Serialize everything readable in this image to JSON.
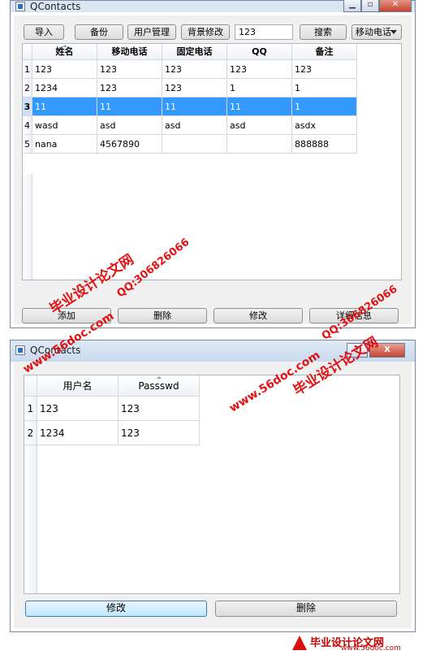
{
  "window1": {
    "title": "QContacts",
    "toolbar": {
      "import_label": "导入",
      "backup_label": "备份",
      "user_manage_label": "用户管理",
      "background_label": "背景修改",
      "search_value": "123",
      "search_button_label": "搜索",
      "search_field_option": "移动电话"
    },
    "table": {
      "headers": [
        "姓名",
        "移动电话",
        "固定电话",
        "QQ",
        "备注"
      ],
      "rows": [
        {
          "num": "1",
          "cells": [
            "123",
            "123",
            "123",
            "123",
            "123"
          ]
        },
        {
          "num": "2",
          "cells": [
            "1234",
            "123",
            "123",
            "1",
            "1"
          ]
        },
        {
          "num": "3",
          "cells": [
            "11",
            "11",
            "11",
            "11",
            "1"
          ]
        },
        {
          "num": "4",
          "cells": [
            "wasd",
            "asd",
            "asd",
            "asd",
            "asdx"
          ]
        },
        {
          "num": "5",
          "cells": [
            "nana",
            "4567890",
            "",
            "",
            "888888"
          ]
        }
      ],
      "selected_row": 3
    },
    "bottom_buttons": {
      "add_label": "添加",
      "delete_label": "删除",
      "edit_label": "修改",
      "detail_label": "详细信息"
    }
  },
  "window2": {
    "title": "QContacts",
    "help_label": "?",
    "close_label": "X",
    "table": {
      "headers": [
        "用户名",
        "Passswd"
      ],
      "rows": [
        {
          "num": "1",
          "cells": [
            "123",
            "123"
          ]
        },
        {
          "num": "2",
          "cells": [
            "1234",
            "123"
          ]
        }
      ]
    },
    "buttons": {
      "edit_label": "修改",
      "delete_label": "删除"
    }
  },
  "watermarks": {
    "site_name": "毕业设计论文网",
    "site_url": "www.56doc.com",
    "qq": "QQ:306826066",
    "footer_text": "毕业设计论文网",
    "footer_url": "www.56doc.com"
  },
  "colors": {
    "selection": "#3399ff",
    "watermark": "#e00000",
    "close_button": "#c3452f"
  }
}
